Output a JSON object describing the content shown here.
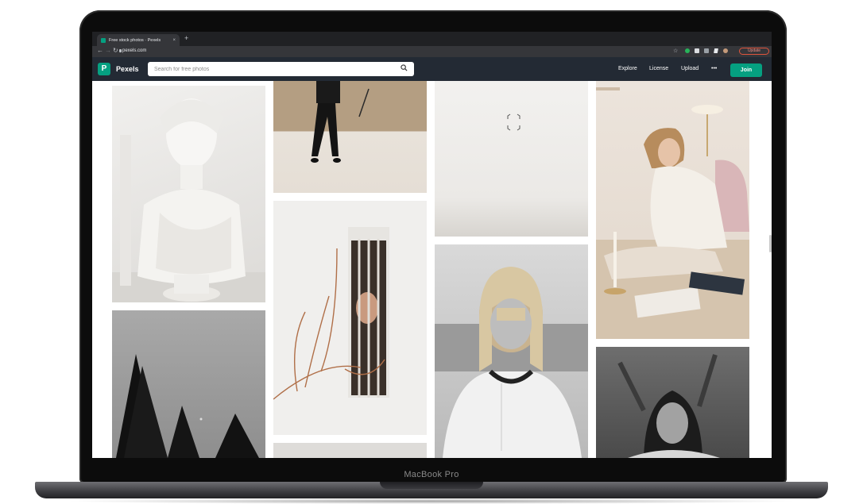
{
  "device": {
    "model_label": "MacBook Pro"
  },
  "browser": {
    "tab_title": "Free stock photos · Pexels",
    "tab_close": "×",
    "new_tab": "+",
    "url": "pexels.com",
    "update_label": "Update"
  },
  "header": {
    "logo_mark": "P",
    "logo_text": "Pexels",
    "search_placeholder": "Search for free photos",
    "nav": [
      "Explore",
      "License",
      "Upload",
      "•••"
    ],
    "join_label": "Join"
  },
  "colors": {
    "brand": "#05a081",
    "header_bg": "#232a34",
    "chrome_bg": "#202124"
  },
  "photos": [
    {
      "subject": "white marble bust sculpture",
      "tone": "light"
    },
    {
      "subject": "person standing in black outfit",
      "tone": "light"
    },
    {
      "subject": "minimal white room with small object",
      "tone": "light"
    },
    {
      "subject": "woman in white sweater sitting on floor",
      "tone": "warm"
    },
    {
      "subject": "dried branches and face behind bars",
      "tone": "light"
    },
    {
      "subject": "black and white portrait of woman with bangs",
      "tone": "mono"
    },
    {
      "subject": "black and white pine trees",
      "tone": "mono"
    },
    {
      "subject": "black and white woman with eyes closed",
      "tone": "mono"
    }
  ]
}
